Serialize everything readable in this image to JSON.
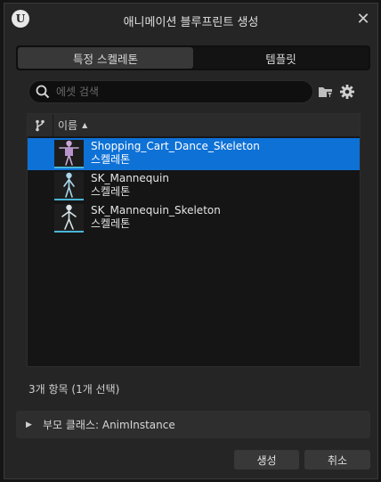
{
  "window": {
    "title": "애니메이션 블루프린트 생성",
    "logo_icon": "unreal-logo-icon",
    "close_icon": "close-icon"
  },
  "tabs": [
    {
      "label": "특정 스켈레톤",
      "active": true
    },
    {
      "label": "템플릿",
      "active": false
    }
  ],
  "search": {
    "placeholder": "에셋 검색",
    "value": "",
    "icon": "search-icon"
  },
  "toolbar": {
    "filter_icon": "folder-filter-icon",
    "settings_icon": "gear-icon"
  },
  "list": {
    "header": {
      "branch_icon": "branch-icon",
      "name_label": "이름",
      "sort": "ascending"
    },
    "items": [
      {
        "name": "Shopping_Cart_Dance_Skeleton",
        "type": "스켈레톤",
        "selected": true,
        "thumb_icon": "skeleton-icon"
      },
      {
        "name": "SK_Mannequin",
        "type": "스켈레톤",
        "selected": false,
        "thumb_icon": "skeleton-icon"
      },
      {
        "name": "SK_Mannequin_Skeleton",
        "type": "스켈레톤",
        "selected": false,
        "thumb_icon": "skeleton-icon"
      }
    ]
  },
  "status": "3개 항목 (1개 선택)",
  "parent_class": {
    "label": "부모 클래스: AnimInstance",
    "expanded": false
  },
  "buttons": {
    "create": "생성",
    "cancel": "취소"
  },
  "colors": {
    "selection": "#0e71d6",
    "thumb_accent": "#4ab6d8",
    "background": "#252525"
  }
}
